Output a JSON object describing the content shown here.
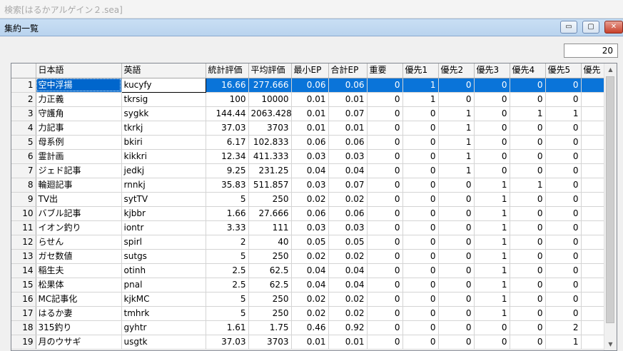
{
  "background_window": {
    "title": "検索[はるかアルゲイン２.sea]"
  },
  "window": {
    "title": "集約一覧",
    "controls": {
      "minimize": "▭",
      "restore": "▢",
      "close": "✕"
    }
  },
  "count_box": {
    "value": "20"
  },
  "grid": {
    "columns": [
      "日本語",
      "英語",
      "統計評価",
      "平均評価",
      "最小EP",
      "合計EP",
      "重要",
      "優先1",
      "優先2",
      "優先3",
      "優先4",
      "優先5",
      "優先"
    ],
    "selected_row": 1,
    "rows": [
      {
        "n": "1",
        "jp": "空中浮揚",
        "en": "kucyfy",
        "c": [
          "16.66",
          "277.666",
          "0.06",
          "0.06",
          "0",
          "1",
          "0",
          "0",
          "0",
          "0",
          ""
        ]
      },
      {
        "n": "2",
        "jp": "力正義",
        "en": "tkrsig",
        "c": [
          "100",
          "10000",
          "0.01",
          "0.01",
          "0",
          "1",
          "0",
          "0",
          "0",
          "0",
          ""
        ]
      },
      {
        "n": "3",
        "jp": "守護角",
        "en": "sygkk",
        "c": [
          "144.44",
          "2063.428",
          "0.01",
          "0.07",
          "0",
          "0",
          "1",
          "0",
          "1",
          "1",
          ""
        ]
      },
      {
        "n": "4",
        "jp": "力記事",
        "en": "tkrkj",
        "c": [
          "37.03",
          "3703",
          "0.01",
          "0.01",
          "0",
          "0",
          "1",
          "0",
          "0",
          "0",
          ""
        ]
      },
      {
        "n": "5",
        "jp": "母系例",
        "en": "bkiri",
        "c": [
          "6.17",
          "102.833",
          "0.06",
          "0.06",
          "0",
          "0",
          "1",
          "0",
          "0",
          "0",
          ""
        ]
      },
      {
        "n": "6",
        "jp": "霊計画",
        "en": "kikkri",
        "c": [
          "12.34",
          "411.333",
          "0.03",
          "0.03",
          "0",
          "0",
          "1",
          "0",
          "0",
          "0",
          ""
        ]
      },
      {
        "n": "7",
        "jp": "ジェド記事",
        "en": "jedkj",
        "c": [
          "9.25",
          "231.25",
          "0.04",
          "0.04",
          "0",
          "0",
          "1",
          "0",
          "0",
          "0",
          ""
        ]
      },
      {
        "n": "8",
        "jp": "輪廻記事",
        "en": "rnnkj",
        "c": [
          "35.83",
          "511.857",
          "0.03",
          "0.07",
          "0",
          "0",
          "0",
          "1",
          "1",
          "0",
          ""
        ]
      },
      {
        "n": "9",
        "jp": "TV出",
        "en": "sytTV",
        "c": [
          "5",
          "250",
          "0.02",
          "0.02",
          "0",
          "0",
          "0",
          "1",
          "0",
          "0",
          ""
        ]
      },
      {
        "n": "10",
        "jp": "バブル記事",
        "en": "kjbbr",
        "c": [
          "1.66",
          "27.666",
          "0.06",
          "0.06",
          "0",
          "0",
          "0",
          "1",
          "0",
          "0",
          ""
        ]
      },
      {
        "n": "11",
        "jp": "イオン釣り",
        "en": "iontr",
        "c": [
          "3.33",
          "111",
          "0.03",
          "0.03",
          "0",
          "0",
          "0",
          "1",
          "0",
          "0",
          ""
        ]
      },
      {
        "n": "12",
        "jp": "らせん",
        "en": "spirl",
        "c": [
          "2",
          "40",
          "0.05",
          "0.05",
          "0",
          "0",
          "0",
          "1",
          "0",
          "0",
          ""
        ]
      },
      {
        "n": "13",
        "jp": "ガセ数値",
        "en": "sutgs",
        "c": [
          "5",
          "250",
          "0.02",
          "0.02",
          "0",
          "0",
          "0",
          "1",
          "0",
          "0",
          ""
        ]
      },
      {
        "n": "14",
        "jp": "稲生夫",
        "en": "otinh",
        "c": [
          "2.5",
          "62.5",
          "0.04",
          "0.04",
          "0",
          "0",
          "0",
          "1",
          "0",
          "0",
          ""
        ]
      },
      {
        "n": "15",
        "jp": "松果体",
        "en": "pnal",
        "c": [
          "2.5",
          "62.5",
          "0.04",
          "0.04",
          "0",
          "0",
          "0",
          "1",
          "0",
          "0",
          ""
        ]
      },
      {
        "n": "16",
        "jp": "MC記事化",
        "en": "kjkMC",
        "c": [
          "5",
          "250",
          "0.02",
          "0.02",
          "0",
          "0",
          "0",
          "1",
          "0",
          "0",
          ""
        ]
      },
      {
        "n": "17",
        "jp": "はるか妻",
        "en": "tmhrk",
        "c": [
          "5",
          "250",
          "0.02",
          "0.02",
          "0",
          "0",
          "0",
          "1",
          "0",
          "0",
          ""
        ]
      },
      {
        "n": "18",
        "jp": "315釣り",
        "en": "gyhtr",
        "c": [
          "1.61",
          "1.75",
          "0.46",
          "0.92",
          "0",
          "0",
          "0",
          "0",
          "0",
          "2",
          ""
        ]
      },
      {
        "n": "19",
        "jp": "月のウサギ",
        "en": "usgtk",
        "c": [
          "37.03",
          "3703",
          "0.01",
          "0.01",
          "0",
          "0",
          "0",
          "0",
          "0",
          "1",
          ""
        ]
      }
    ]
  },
  "scrollbar": {
    "up_icon": "▲",
    "down_icon": "▼"
  }
}
